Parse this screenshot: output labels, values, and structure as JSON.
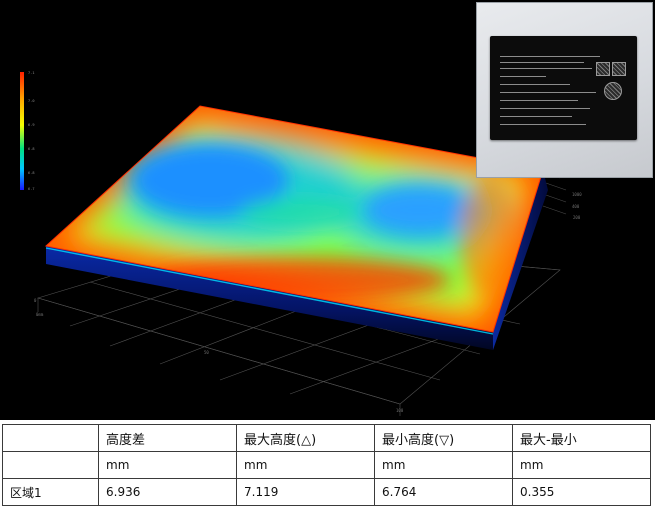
{
  "colors": {
    "background": "#000000",
    "surface_high": "#ff3a00",
    "surface_mid": "#ffe600",
    "surface_low": "#1a73ff",
    "table_border": "#3a3a3a"
  },
  "viewport": {
    "icons": [
      "height-map-3d",
      "color-scale-legend",
      "axis-grid",
      "nameplate-photo"
    ]
  },
  "table": {
    "headers": [
      "",
      "高度差",
      "最大高度(△)",
      "最小高度(▽)",
      "最大-最小"
    ],
    "units": [
      "",
      "mm",
      "mm",
      "mm",
      "mm"
    ],
    "rows": [
      {
        "label": "区域1",
        "values": [
          "6.936",
          "7.119",
          "6.764",
          "0.355"
        ]
      }
    ]
  }
}
